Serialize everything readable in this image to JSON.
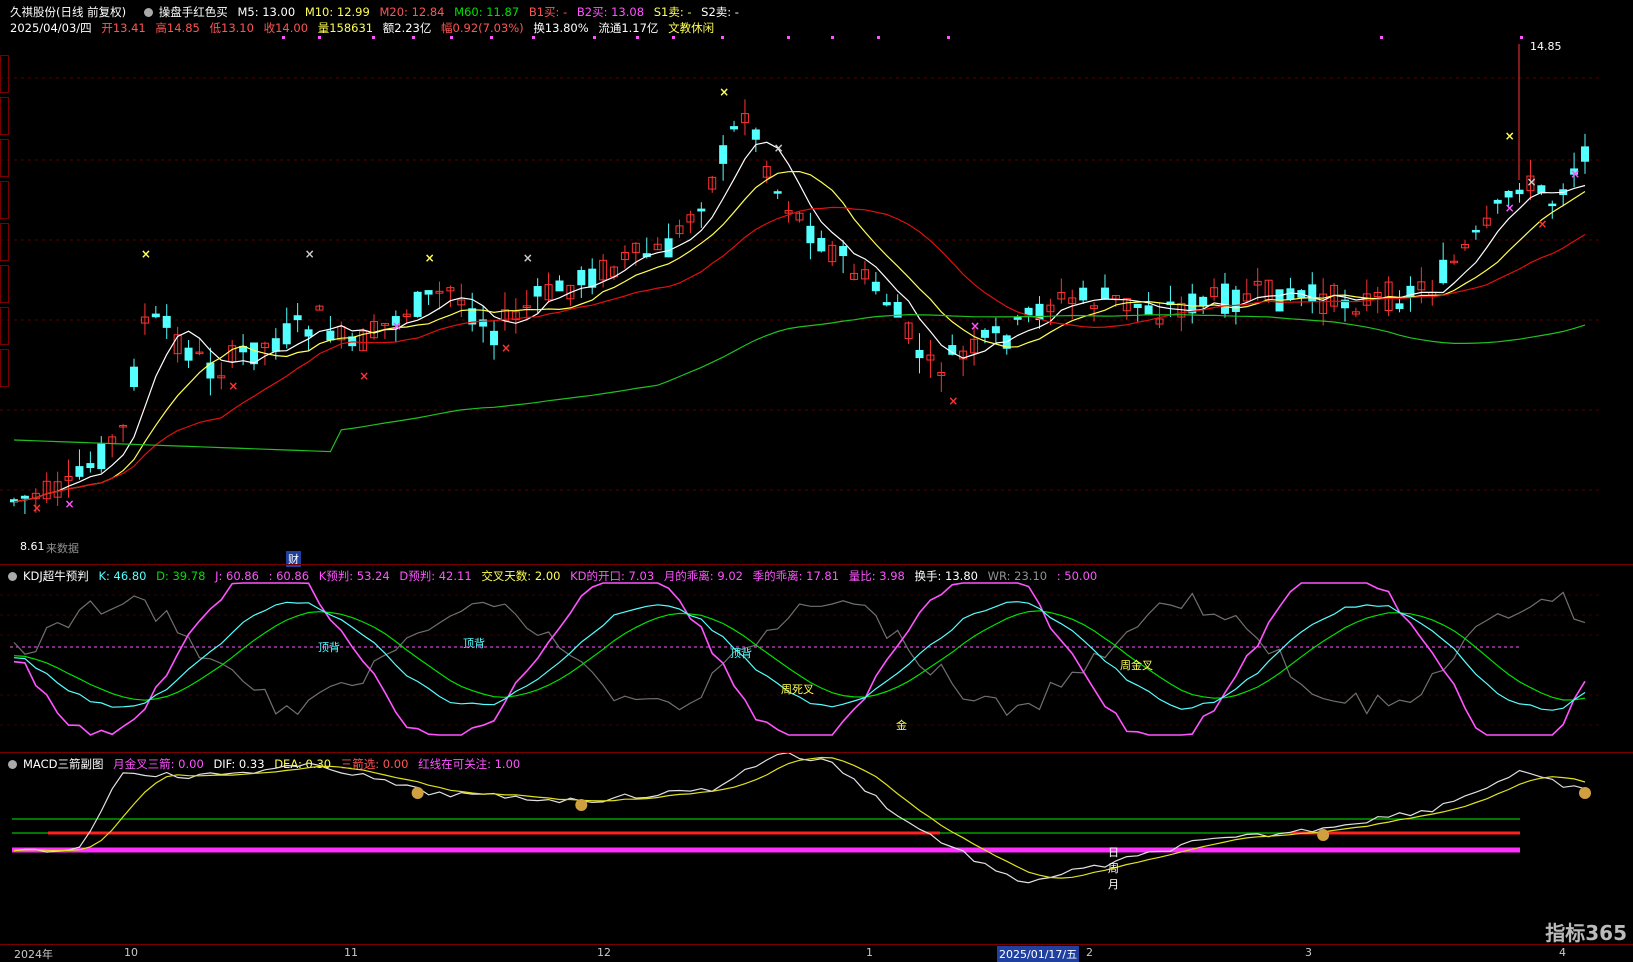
{
  "main_header": {
    "stock_name": "久祺股份(日线 前复权)",
    "indicator_name": "操盘手红色买",
    "ma5": "M5: 13.00",
    "ma10": "M10: 12.99",
    "ma20": "M20: 12.84",
    "ma60": "M60: 11.87",
    "b1": "B1买: -",
    "b2": "B2买: 13.08",
    "s1": "S1卖: -",
    "s2": "S2卖: -"
  },
  "quote_line": {
    "date": "2025/04/03/四",
    "open": "开13.41",
    "high": "高14.85",
    "low": "低13.10",
    "close": "收14.00",
    "volume": "量158631",
    "amount": "额2.23亿",
    "change": "幅0.92(7.03%)",
    "turnover": "换13.80%",
    "float": "流通1.17亿",
    "industry": "文教休闲"
  },
  "main_annotations": {
    "high_price": "14.85",
    "low_price": "8.61",
    "no_data": "来数据",
    "finance_tag": "财"
  },
  "kdj_header": {
    "name": "KDJ超牛预判",
    "k": "K: 46.80",
    "d": "D: 39.78",
    "j": "J: 60.86",
    "jx": ": 60.86",
    "k_pred": "K预判: 53.24",
    "d_pred": "D预判: 42.11",
    "cross_days": "交叉天数: 2.00",
    "kd_open": "KD的开口: 7.03",
    "month_dev": "月的乖离: 9.02",
    "season_dev": "季的乖离: 17.81",
    "vol_ratio": "量比: 3.98",
    "turnover": "换手: 13.80",
    "wr": "WR: 23.10",
    "fifty": ": 50.00"
  },
  "kdj_labels": {
    "top1": "顶背",
    "top2": "顶背",
    "top3": "顶背",
    "week_dead": "周死叉",
    "week_gold": "周金叉",
    "gold": "金"
  },
  "macd_header": {
    "name": "MACD三箭副图",
    "month_gold": "月金叉三箭: 0.00",
    "dif": "DIF: 0.33",
    "dea": "DEA: 0.30",
    "three_arrows": "三箭选: 0.00",
    "red_line": "红线在可关注: 1.00"
  },
  "macd_labels": {
    "day": "日",
    "week": "周",
    "month": "月"
  },
  "x_axis": {
    "labels": [
      "2024年",
      "10",
      "11",
      "12",
      "1",
      "2025/01/17/五",
      "2",
      "3",
      "4"
    ]
  },
  "watermark": "指标365",
  "colors": {
    "up": "#ff3232",
    "down": "#54ffff",
    "ma5": "#ffffff",
    "ma10": "#ffff54",
    "ma20": "#e01010",
    "ma60": "#20c020"
  }
}
